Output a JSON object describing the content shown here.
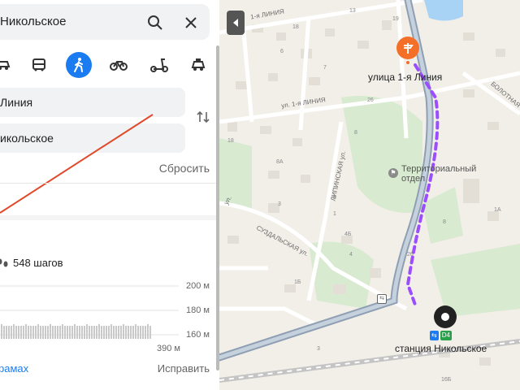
{
  "search": {
    "value": "Никольское"
  },
  "transport_modes": [
    {
      "icon": "car-icon"
    },
    {
      "icon": "bus-icon"
    },
    {
      "icon": "walk-icon",
      "active": true
    },
    {
      "icon": "bicycle-icon"
    },
    {
      "icon": "scooter-icon"
    },
    {
      "icon": "taxi-icon"
    }
  ],
  "route_fields": {
    "from": "Линия",
    "to": "икольское",
    "reset_label": "Сбросить"
  },
  "route_info": {
    "steps": "548 шагов",
    "elevation_ticks": [
      "200 м",
      "180 м",
      "160 м"
    ],
    "distance": "390 м",
    "bottom_left_link": "рамах",
    "bottom_right_link": "Исправить"
  },
  "map": {
    "destination_label": "улица 1-я Линия",
    "station_label": "станция Никольское",
    "badge_text": "D4",
    "poi_label_line1": "Территориальный",
    "poi_label_line2": "отдел",
    "streets": {
      "first_line_top": "1-я ЛИНИЯ",
      "first_line_mid": "ул. 1-я ЛИНИЯ",
      "lipinskaya": "ЛИПИНСКАЯ ул.",
      "suzdalskaya": "СУЗДАЛЬСКАЯ ул.",
      "bolotnaya": "БОЛОТНАЯ",
      "ul_left": "ул."
    },
    "house_numbers": [
      "19",
      "13",
      "18",
      "6",
      "7",
      "26",
      "8",
      "18",
      "8А",
      "3",
      "1",
      "5",
      "4Б",
      "4",
      "1Б",
      "26",
      "8",
      "1А",
      "16Б",
      "3"
    ]
  },
  "colors": {
    "accent": "#1a7cf0",
    "destination": "#f46f28",
    "route": "#9b4dff",
    "straight_line": "#e04a2a"
  }
}
